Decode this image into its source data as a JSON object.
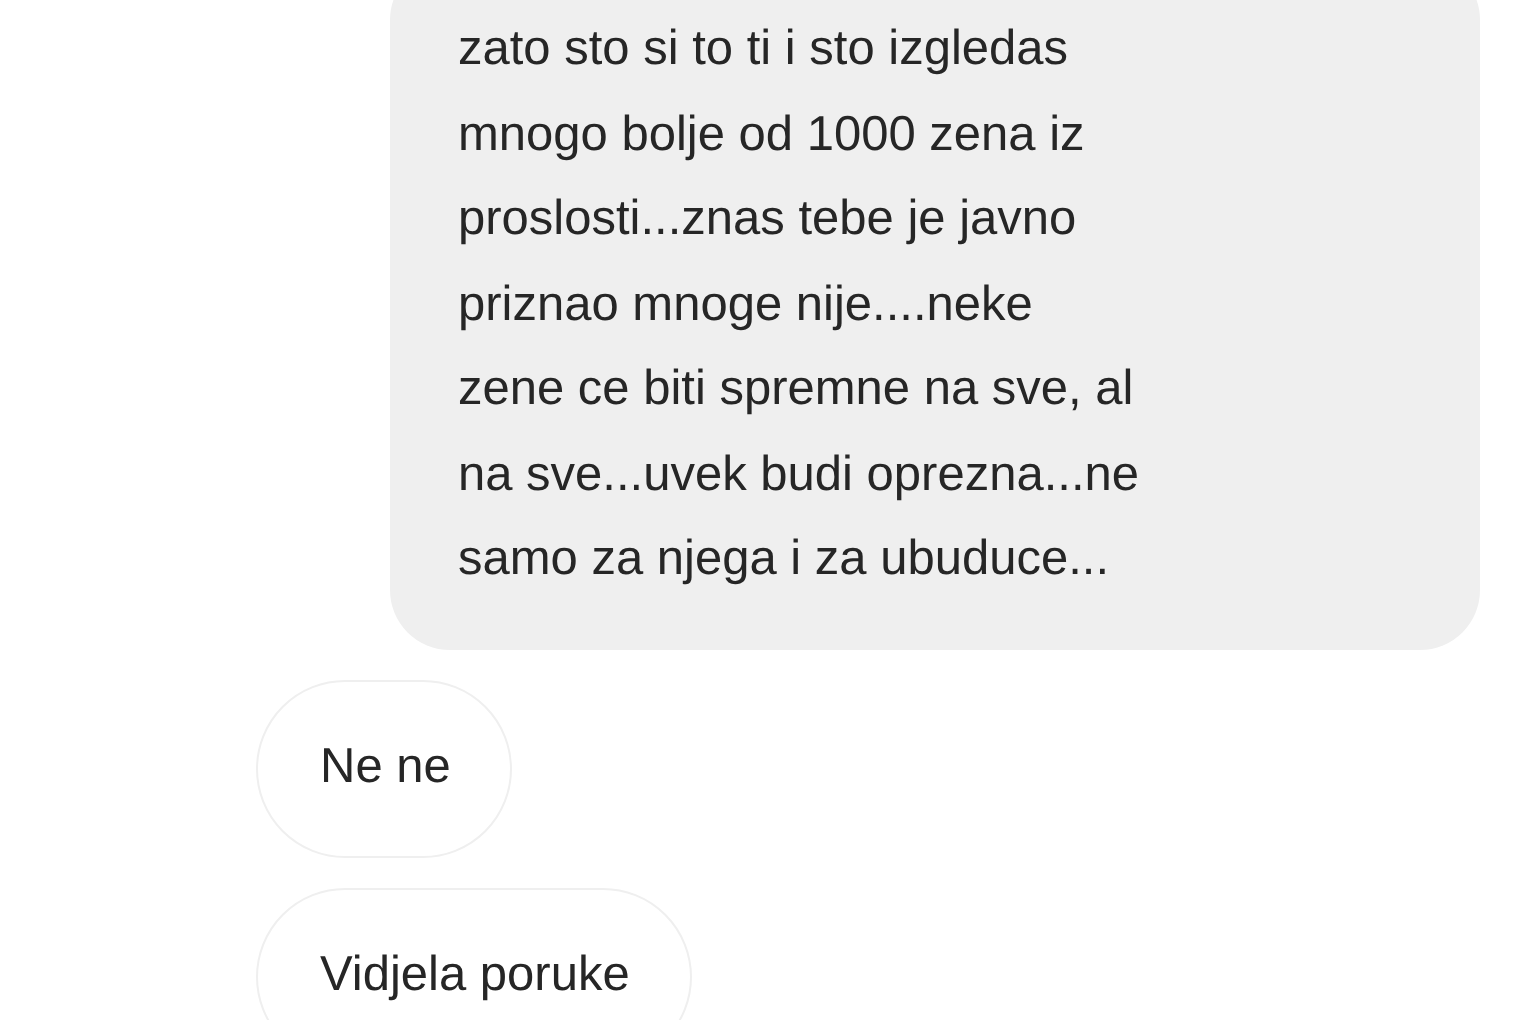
{
  "messages": [
    {
      "kind": "sent",
      "lines": [
        "zato sto si to ti i sto izgledas",
        "mnogo bolje od 1000 zena iz",
        "proslosti...znas tebe je javno",
        "priznao mnoge nije....neke",
        "zene ce biti spremne na sve, al",
        "na sve...uvek budi oprezna...ne",
        "samo za njega i za ubuduce..."
      ]
    },
    {
      "kind": "received",
      "lines": [
        "Ne ne"
      ]
    },
    {
      "kind": "received",
      "lines": [
        "Vidjela poruke"
      ]
    }
  ]
}
